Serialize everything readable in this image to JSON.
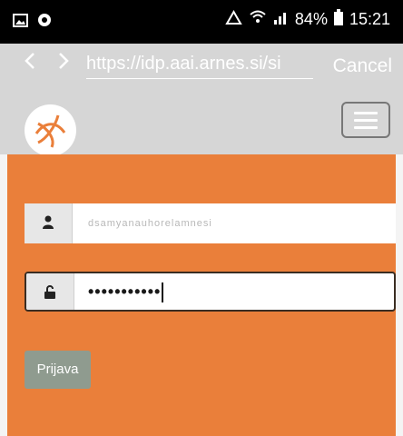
{
  "status_bar": {
    "left_icons": [
      "image-icon",
      "notification-icon"
    ],
    "right_icons": [
      "sync-icon",
      "wifi-icon",
      "signal-icon",
      "battery-icon"
    ],
    "battery": "84%",
    "time": "15:21"
  },
  "browser": {
    "back_icon": "back-chevron-icon",
    "forward_icon": "forward-chevron-icon",
    "url": "https://idp.aai.arnes.si/si",
    "cancel_label": "Cancel"
  },
  "header": {
    "logo": "arnes-logo-icon",
    "menu_icon": "hamburger-icon"
  },
  "login": {
    "username_icon": "user-icon",
    "username_value": "dsamyanauhorelamnesi",
    "password_icon": "unlock-icon",
    "password_value": "•••••••••••",
    "submit_label": "Prijava"
  },
  "colors": {
    "status_bar": "#000000",
    "browser_bar": "#d6d6d6",
    "main_background": "#ea7f3a",
    "button": "#8f9b8f",
    "focus_border": "#3a2d22"
  }
}
